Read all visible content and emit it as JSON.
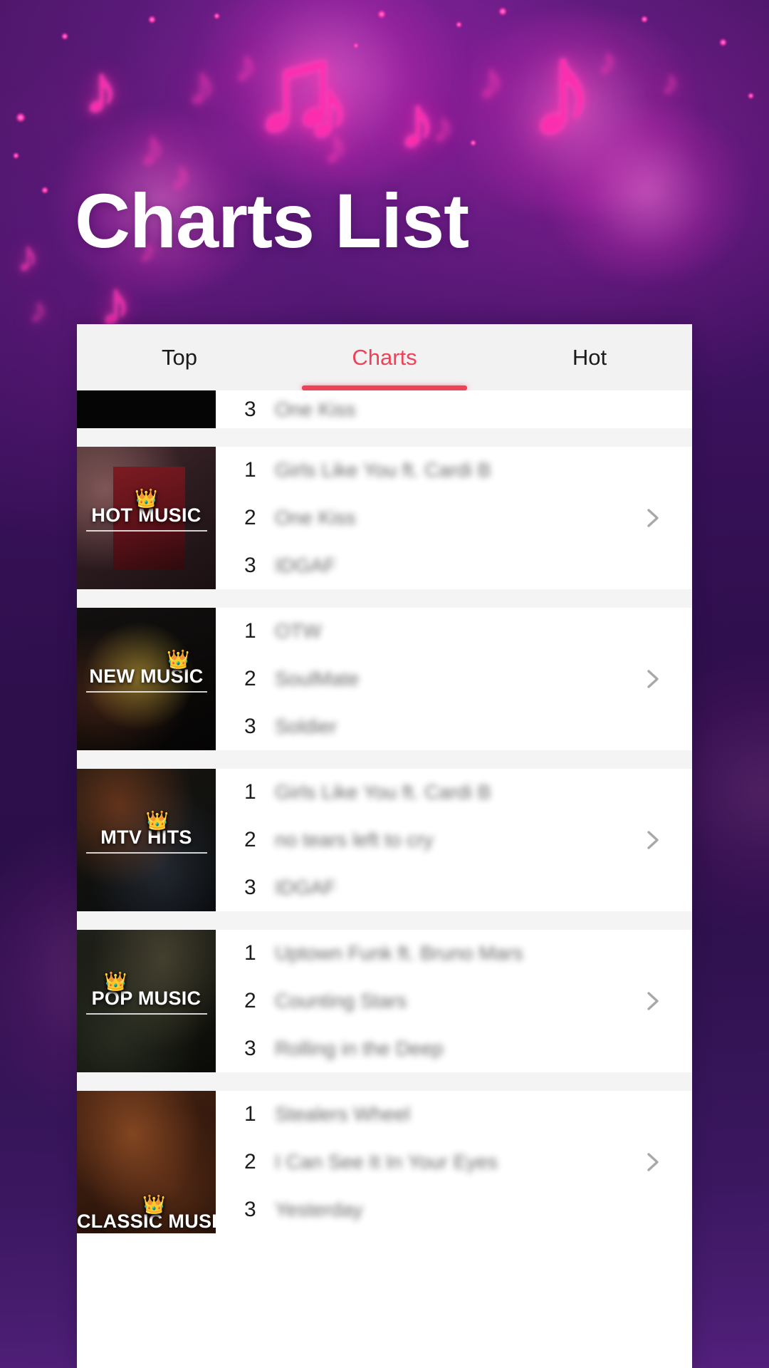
{
  "page": {
    "title": "Charts List",
    "background_top_color": "#4a1465",
    "background_bottom_color": "#53207c",
    "accent_color": "#ef4158"
  },
  "tabs": [
    {
      "label": "Top",
      "active": false
    },
    {
      "label": "Charts",
      "active": true
    },
    {
      "label": "Hot",
      "active": false
    }
  ],
  "chevron_icon": "chevron-right-icon",
  "crown_icon": "👑",
  "list": {
    "partial_row": {
      "songs": [
        {
          "rank": "3",
          "title": "One Kiss"
        }
      ]
    },
    "rows": [
      {
        "label": "HOT MUSIC",
        "songs": [
          {
            "rank": "1",
            "title": "Girls Like You ft. Cardi B"
          },
          {
            "rank": "2",
            "title": "One Kiss"
          },
          {
            "rank": "3",
            "title": "IDGAF"
          }
        ]
      },
      {
        "label": "NEW MUSIC",
        "songs": [
          {
            "rank": "1",
            "title": "OTW"
          },
          {
            "rank": "2",
            "title": "SoulMate"
          },
          {
            "rank": "3",
            "title": "Soldier"
          }
        ]
      },
      {
        "label": "MTV HITS",
        "songs": [
          {
            "rank": "1",
            "title": "Girls Like You ft. Cardi B"
          },
          {
            "rank": "2",
            "title": "no tears left to cry"
          },
          {
            "rank": "3",
            "title": "IDGAF"
          }
        ]
      },
      {
        "label": "POP MUSIC",
        "songs": [
          {
            "rank": "1",
            "title": "Uptown Funk ft. Bruno Mars"
          },
          {
            "rank": "2",
            "title": "Counting Stars"
          },
          {
            "rank": "3",
            "title": "Rolling in the Deep"
          }
        ]
      },
      {
        "label": "CLASSIC MUSIC",
        "songs": [
          {
            "rank": "1",
            "title": "Stealers Wheel"
          },
          {
            "rank": "2",
            "title": "I Can See It In Your Eyes"
          },
          {
            "rank": "3",
            "title": "Yesterday"
          }
        ]
      }
    ]
  }
}
